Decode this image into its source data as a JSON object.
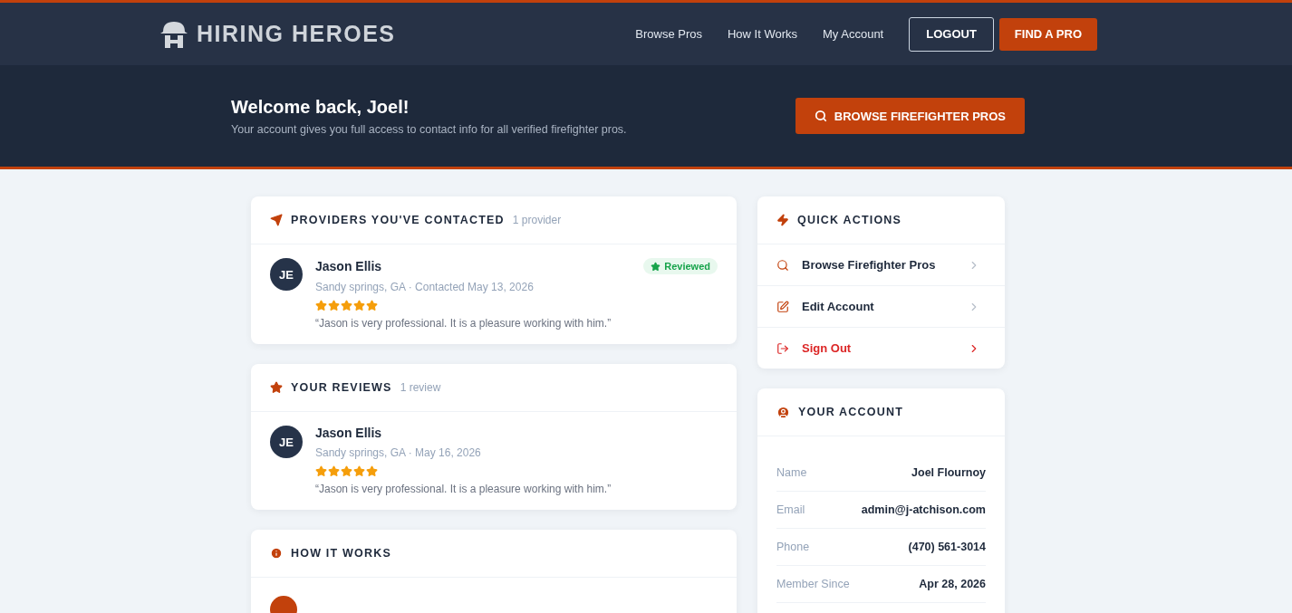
{
  "header": {
    "brand": "HIRING HEROES",
    "nav": [
      "Browse Pros",
      "How It Works",
      "My Account"
    ],
    "logout": "LOGOUT",
    "cta": "FIND A PRO"
  },
  "hero": {
    "title": "Welcome back, Joel!",
    "subtitle": "Your account gives you full access to contact info for all verified firefighter pros.",
    "button": "BROWSE FIREFIGHTER PROS"
  },
  "contacted": {
    "title": "PROVIDERS YOU'VE CONTACTED",
    "count": "1 provider",
    "items": [
      {
        "initials": "JE",
        "name": "Jason Ellis",
        "meta": "Sandy springs, GA · Contacted May 13, 2026",
        "stars": 5,
        "quote": "“Jason is very professional. It is a pleasure working with him.”",
        "badge": "Reviewed"
      }
    ]
  },
  "reviews": {
    "title": "YOUR REVIEWS",
    "count": "1 review",
    "items": [
      {
        "initials": "JE",
        "name": "Jason Ellis",
        "meta": "Sandy springs, GA · May 16, 2026",
        "stars": 5,
        "quote": "“Jason is very professional. It is a pleasure working with him.”"
      }
    ]
  },
  "how_it_works": {
    "title": "HOW IT WORKS"
  },
  "quick_actions": {
    "title": "QUICK ACTIONS",
    "items": [
      {
        "kind": "search",
        "label": "Browse Firefighter Pros"
      },
      {
        "kind": "edit",
        "label": "Edit Account"
      },
      {
        "kind": "signout",
        "label": "Sign Out"
      }
    ]
  },
  "account": {
    "title": "YOUR ACCOUNT",
    "rows": [
      {
        "label": "Name",
        "value": "Joel Flournoy"
      },
      {
        "label": "Email",
        "value": "admin@j-atchison.com"
      },
      {
        "label": "Phone",
        "value": "(470) 561-3014"
      },
      {
        "label": "Member Since",
        "value": "Apr 28, 2026"
      }
    ]
  }
}
